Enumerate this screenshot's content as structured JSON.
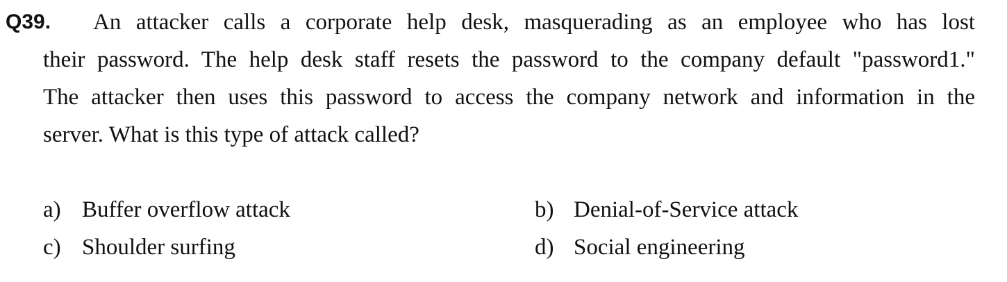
{
  "question": {
    "number": "Q39.",
    "lines": [
      "An attacker calls a corporate help desk, masquerading as an employee who has lost",
      "their password. The help desk staff resets the password to the company default \"password1.\"",
      "The attacker then uses this password to access the company network and information in the",
      "server. What is this type of attack called?"
    ]
  },
  "options": [
    {
      "letter": "a)",
      "text": "Buffer overflow attack"
    },
    {
      "letter": "b)",
      "text": "Denial-of-Service attack"
    },
    {
      "letter": "c)",
      "text": "Shoulder surfing"
    },
    {
      "letter": "d)",
      "text": "Social engineering"
    }
  ]
}
